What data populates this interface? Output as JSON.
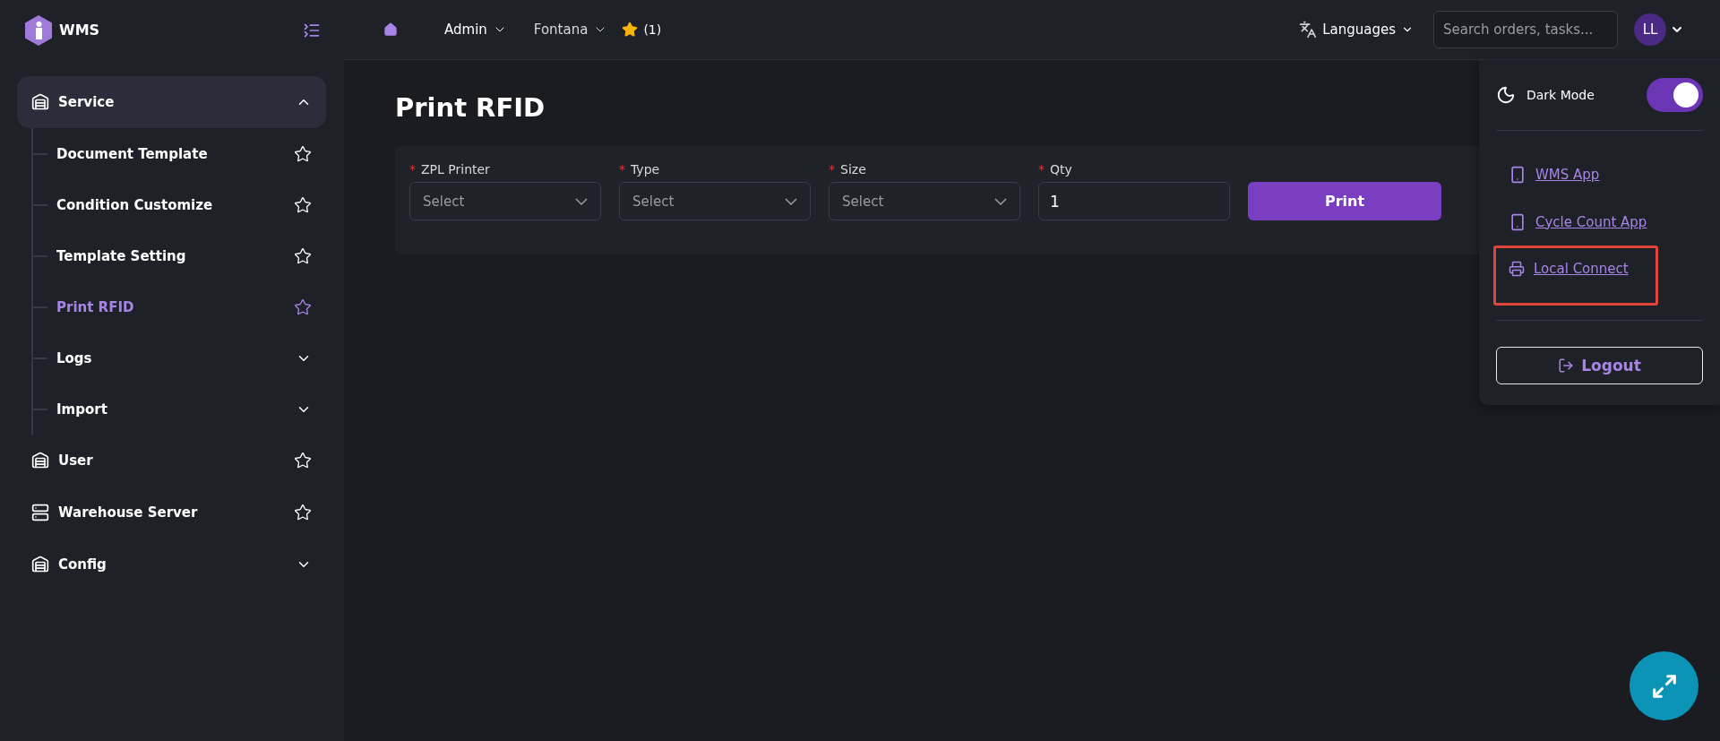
{
  "brand": {
    "name": "WMS"
  },
  "sidebar": {
    "items": [
      {
        "label": "Service",
        "kind": "group",
        "expanded": true,
        "children": [
          {
            "label": "Document Template",
            "kind": "page",
            "selected": false
          },
          {
            "label": "Condition Customize",
            "kind": "page",
            "selected": false
          },
          {
            "label": "Template Setting",
            "kind": "page",
            "selected": false
          },
          {
            "label": "Print RFID",
            "kind": "page",
            "selected": true
          },
          {
            "label": "Logs",
            "kind": "group",
            "selected": false
          },
          {
            "label": "Import",
            "kind": "group",
            "selected": false
          }
        ]
      },
      {
        "label": "User",
        "kind": "page"
      },
      {
        "label": "Warehouse Server",
        "kind": "page"
      },
      {
        "label": "Config",
        "kind": "group",
        "expanded": false
      }
    ]
  },
  "topbar": {
    "menus": [
      {
        "label": "Admin"
      },
      {
        "label": "Fontana"
      }
    ],
    "favorites": "(1)",
    "languages": "Languages",
    "search": {
      "placeholder": "Search orders, tasks..."
    },
    "avatar": "LL"
  },
  "page": {
    "title": "Print RFID",
    "fields": [
      {
        "label": "ZPL Printer",
        "required_mark": "*",
        "kind": "select",
        "placeholder": "Select"
      },
      {
        "label": "Type",
        "required_mark": "*",
        "kind": "select",
        "placeholder": "Select"
      },
      {
        "label": "Size",
        "required_mark": "*",
        "kind": "select",
        "placeholder": "Select"
      },
      {
        "label": "Qty",
        "required_mark": "*",
        "kind": "number",
        "value": "1"
      }
    ],
    "button": "Print"
  },
  "user_menu": {
    "dark_mode": {
      "label": "Dark Mode",
      "on": true
    },
    "links": [
      {
        "label": "WMS App",
        "kind": "phone",
        "highlighted": false
      },
      {
        "label": "Cycle Count App",
        "kind": "phone",
        "highlighted": false
      },
      {
        "label": "Local Connect",
        "kind": "printer",
        "highlighted": true
      }
    ],
    "logout": "Logout"
  }
}
